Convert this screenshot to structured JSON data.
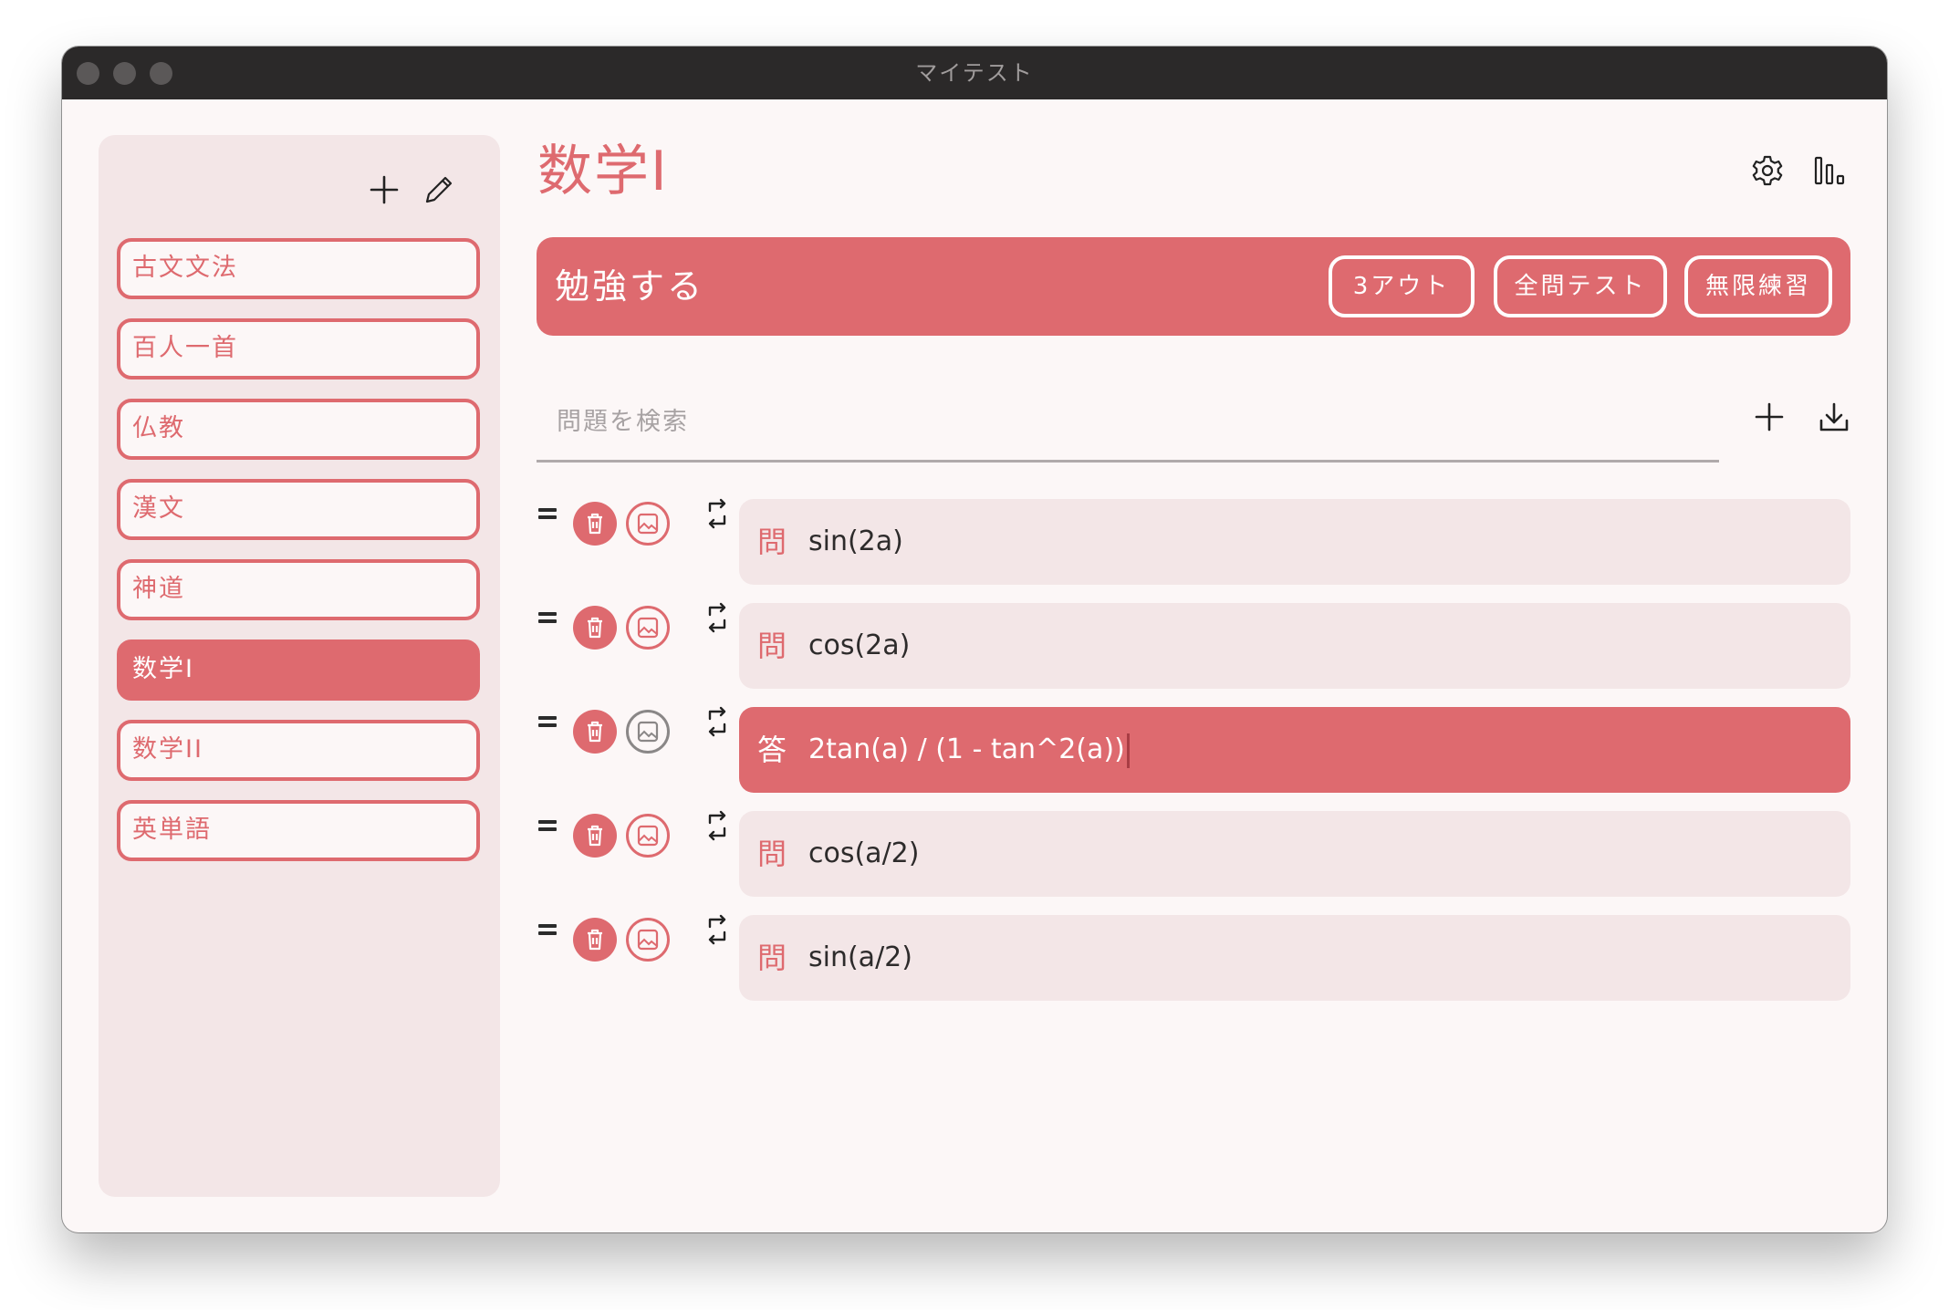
{
  "window": {
    "title": "マイテスト",
    "accent_color": "#de6a6f"
  },
  "sidebar": {
    "tools": [
      "plus-icon",
      "pencil-icon"
    ],
    "items": [
      {
        "label": "古文文法",
        "active": false
      },
      {
        "label": "百人一首",
        "active": false
      },
      {
        "label": "仏教",
        "active": false
      },
      {
        "label": "漢文",
        "active": false
      },
      {
        "label": "神道",
        "active": false
      },
      {
        "label": "数学I",
        "active": true
      },
      {
        "label": "数学II",
        "active": false
      },
      {
        "label": "英単語",
        "active": false
      }
    ]
  },
  "main": {
    "title": "数学I",
    "header_icons": [
      "gear-icon",
      "bar-chart-icon"
    ],
    "study": {
      "label": "勉強する",
      "buttons": [
        "3アウト",
        "全問テスト",
        "無限練習"
      ]
    },
    "search": {
      "placeholder": "問題を検索",
      "value": ""
    },
    "list_icons": [
      "plus-icon",
      "download-icon"
    ],
    "questions": [
      {
        "kind": "問",
        "text": "sin(2a)",
        "active": false
      },
      {
        "kind": "問",
        "text": "cos(2a)",
        "active": false
      },
      {
        "kind": "答",
        "text": "2tan(a) / (1 - tan^2(a))",
        "active": true
      },
      {
        "kind": "問",
        "text": "cos(a/2)",
        "active": false
      },
      {
        "kind": "問",
        "text": "sin(a/2)",
        "active": false
      }
    ]
  }
}
